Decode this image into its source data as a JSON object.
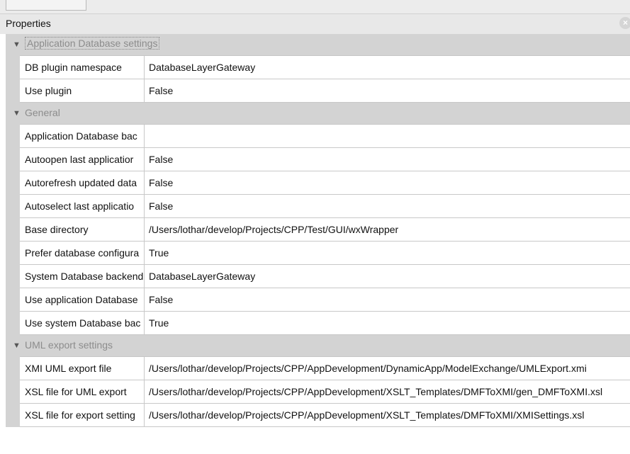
{
  "panel": {
    "title": "Properties",
    "close_glyph": "×"
  },
  "categories": [
    {
      "label": "Application Database settings",
      "rows": [
        {
          "name": "DB plugin namespace",
          "value": "DatabaseLayerGateway"
        },
        {
          "name": "Use plugin",
          "value": "False"
        }
      ]
    },
    {
      "label": "General",
      "rows": [
        {
          "name": "Application Database bac",
          "value": ""
        },
        {
          "name": "Autoopen last applicatior",
          "value": "False"
        },
        {
          "name": "Autorefresh updated data",
          "value": "False"
        },
        {
          "name": "Autoselect last applicatio",
          "value": "False"
        },
        {
          "name": "Base directory",
          "value": "/Users/lothar/develop/Projects/CPP/Test/GUI/wxWrapper"
        },
        {
          "name": "Prefer database configura",
          "value": "True"
        },
        {
          "name": "System Database backend",
          "value": "DatabaseLayerGateway"
        },
        {
          "name": "Use application Database",
          "value": "False"
        },
        {
          "name": "Use system Database bac",
          "value": "True"
        }
      ]
    },
    {
      "label": "UML export settings",
      "rows": [
        {
          "name": "XMI UML export file",
          "value": "/Users/lothar/develop/Projects/CPP/AppDevelopment/DynamicApp/ModelExchange/UMLExport.xmi"
        },
        {
          "name": "XSL file for UML export",
          "value": "/Users/lothar/develop/Projects/CPP/AppDevelopment/XSLT_Templates/DMFToXMI/gen_DMFToXMI.xsl"
        },
        {
          "name": "XSL file for export setting",
          "value": "/Users/lothar/develop/Projects/CPP/AppDevelopment/XSLT_Templates/DMFToXMI/XMISettings.xsl"
        }
      ]
    }
  ],
  "icons": {
    "expanded": "expanded-triangle-icon",
    "close": "close-icon"
  },
  "colors": {
    "category_bg": "#d3d3d3",
    "category_text": "#8c8c8c",
    "grid_line": "#c8c8c8"
  }
}
